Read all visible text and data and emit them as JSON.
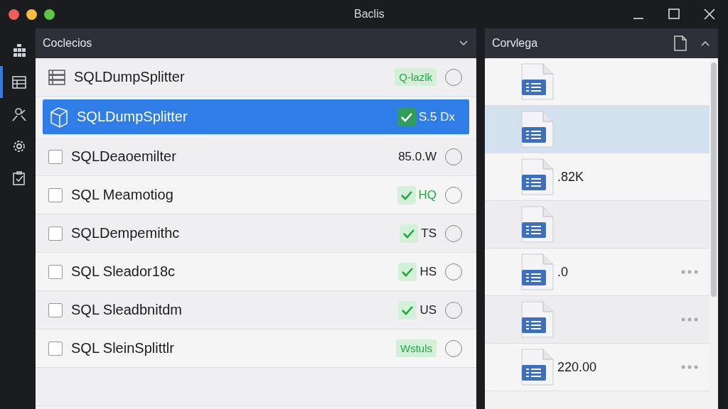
{
  "window": {
    "title": "Baclis"
  },
  "sidebar": {
    "items": [
      {
        "selected": false
      },
      {
        "selected": true
      },
      {
        "selected": false
      },
      {
        "selected": false
      },
      {
        "selected": false
      }
    ]
  },
  "left_panel": {
    "title": "Coclecios",
    "rows": [
      {
        "kind": "list",
        "name": "SQLDumpSplitter",
        "badge": {
          "kind": "pill",
          "text": "Q-lazlk"
        },
        "selected": false
      },
      {
        "kind": "box",
        "name": "SQLDumpSplitter",
        "badge": {
          "kind": "check",
          "text": "S.5 Dx"
        },
        "selected": true
      },
      {
        "kind": "checkbox",
        "checked": false,
        "name": "SQLDeaoemilter",
        "badge": {
          "kind": "plain",
          "text": "85.0.W"
        },
        "selected": false
      },
      {
        "kind": "checkbox",
        "checked": false,
        "name": "SQL Meamotiog",
        "badge": {
          "kind": "check",
          "text": "HQ"
        },
        "selected": false
      },
      {
        "kind": "checkbox",
        "checked": false,
        "name": "SQLDempemithc",
        "badge": {
          "kind": "check",
          "text": "TS"
        },
        "selected": false
      },
      {
        "kind": "checkbox",
        "checked": false,
        "name": "SQL Sleador18c",
        "badge": {
          "kind": "check",
          "text": "HS"
        },
        "selected": false
      },
      {
        "kind": "checkbox",
        "checked": false,
        "name": "SQL Sleadbnitdm",
        "badge": {
          "kind": "check",
          "text": "US"
        },
        "selected": false
      },
      {
        "kind": "checkbox",
        "checked": false,
        "name": "SQL SleinSplittlr",
        "badge": {
          "kind": "pill",
          "text": "Wstuls"
        },
        "selected": false
      }
    ]
  },
  "right_panel": {
    "title": "Corvlega",
    "rows": [
      {
        "selected": false,
        "more": false
      },
      {
        "selected": true,
        "more": false
      },
      {
        "selected": false,
        "size": ".82K",
        "more": false
      },
      {
        "selected": false,
        "more": false
      },
      {
        "selected": false,
        "size": ".0",
        "more": true
      },
      {
        "selected": false,
        "more": true
      },
      {
        "selected": false,
        "size": "220.00",
        "more": true
      }
    ]
  }
}
